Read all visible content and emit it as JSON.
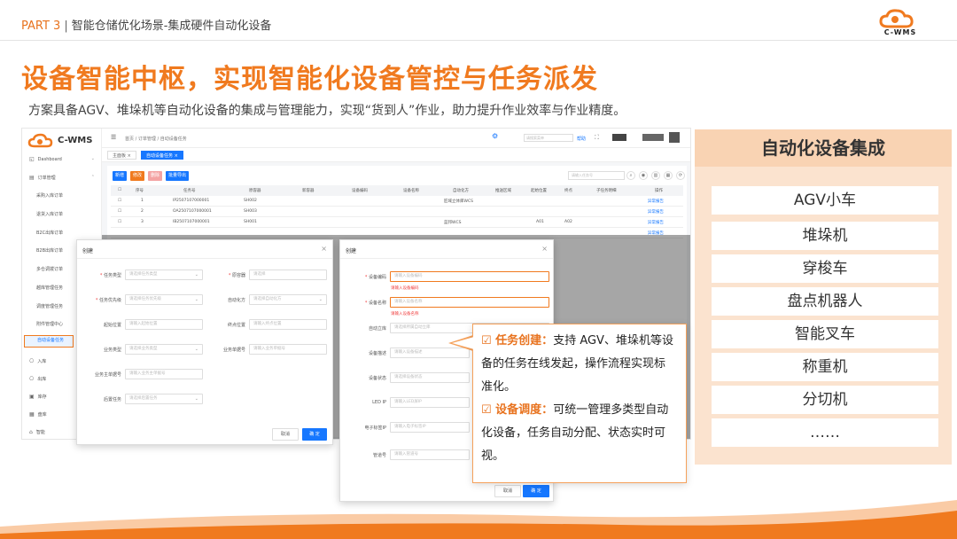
{
  "header": {
    "part": "PART 3",
    "section": "智能仓储优化场景-集成硬件自动化设备",
    "logo_text": "C-WMS"
  },
  "title": "设备智能中枢，实现智能化设备管控与任务派发",
  "subtitle": "方案具备AGV、堆垛机等自动化设备的集成与管理能力，实现“货到人”作业，助力提升作业效率与作业精度。",
  "app": {
    "logo_text": "C-WMS",
    "sidebar": [
      {
        "icon": "dashboard-icon",
        "label": "Dashboard"
      },
      {
        "icon": "order-icon",
        "label": "订单管理"
      },
      {
        "label": "采购入库订单"
      },
      {
        "label": "退货入库订单"
      },
      {
        "label": "B2C出库订单"
      },
      {
        "label": "B2B出库订单"
      },
      {
        "label": "多仓调拨订单"
      },
      {
        "label": "越库管理任务"
      },
      {
        "label": "调度管理任务"
      },
      {
        "label": "附件管理中心"
      },
      {
        "label": "自动设备任务"
      },
      {
        "icon": "inbound-icon",
        "label": "入库"
      },
      {
        "icon": "outbound-icon",
        "label": "出库"
      },
      {
        "icon": "stock-icon",
        "label": "库存"
      },
      {
        "icon": "inventory-icon",
        "label": "盘库"
      },
      {
        "icon": "smart-icon",
        "label": "智能"
      }
    ],
    "breadcrumb": "首页 / 订单管理 / 自动设备任务",
    "topbar": {
      "search_placeholder": "请搜索菜单",
      "help": "帮助"
    },
    "tabs": [
      "主面板",
      "自动设备任务"
    ],
    "toolbar": {
      "buttons": [
        "新增",
        "修改",
        "删除",
        "批量导出"
      ],
      "search_placeholder": "请输入任务号"
    },
    "table": {
      "headers": [
        "序号",
        "任务号",
        "原容器",
        "新容器",
        "设备编码",
        "设备名称",
        "自动化方",
        "推送区域",
        "起始位置",
        "终点",
        "子任务明细",
        "操作"
      ],
      "rows": [
        {
          "no": "1",
          "task": "IP2507107000001",
          "src": "SH002",
          "auto": "匠域立体库WCS",
          "start": "",
          "end": "",
          "op": "异常报告"
        },
        {
          "no": "2",
          "task": "OA2507107000001",
          "src": "SH003",
          "auto": "",
          "start": "",
          "end": "",
          "op": "异常报告"
        },
        {
          "no": "3",
          "task": "IB2507107000001",
          "src": "SH001",
          "auto": "蓝邦WCS",
          "start": "A01",
          "end": "A02",
          "op": "异常报告"
        },
        {
          "no": "",
          "task": "",
          "src": "",
          "auto": "",
          "start": "",
          "end": "",
          "op": "异常报告"
        }
      ]
    },
    "dialog1": {
      "title": "创建",
      "fields": [
        {
          "label": "任务类型",
          "required": true,
          "placeholder": "请选择任务类型"
        },
        {
          "label": "原容器",
          "required": true,
          "placeholder": "请选择"
        },
        {
          "label": "任务优先级",
          "required": true,
          "placeholder": "请选择任务优先级"
        },
        {
          "label": "自动化方",
          "required": false,
          "placeholder": "请选择自动化方"
        },
        {
          "label": "起始位置",
          "required": false,
          "placeholder": "请输入起始位置"
        },
        {
          "label": "终点位置",
          "required": false,
          "placeholder": "请输入终点位置"
        },
        {
          "label": "业务类型",
          "required": false,
          "placeholder": "请选择业务类型"
        },
        {
          "label": "业务单据号",
          "required": false,
          "placeholder": "请输入业务单据号"
        },
        {
          "label": "业务主单据号",
          "required": false,
          "placeholder": "请输入业务主单据号"
        },
        {
          "label": "后置任务",
          "required": false,
          "placeholder": "请选择后置任务"
        }
      ],
      "cancel": "取消",
      "ok": "确 定"
    },
    "dialog2": {
      "title": "创建",
      "fields": [
        {
          "label": "设备编码",
          "required": true,
          "placeholder": "请输入设备编码",
          "error": "请输入设备编码"
        },
        {
          "label": "设备名称",
          "required": true,
          "placeholder": "请输入设备名称",
          "error": "请输入设备名称"
        },
        {
          "label": "自动立库",
          "required": false,
          "placeholder": "请选择所属自动立库"
        },
        {
          "label": "设备描述",
          "required": false,
          "placeholder": "请输入设备描述"
        },
        {
          "label": "设备状态",
          "required": false,
          "placeholder": "请选择设备状态"
        },
        {
          "label": "LED IP",
          "required": false,
          "placeholder": "请输入LED屏IP"
        },
        {
          "label": "电子标签IP",
          "required": false,
          "placeholder": "请输入电子标签IP"
        },
        {
          "label": "管道号",
          "required": false,
          "placeholder": "请输入管道号"
        }
      ],
      "cancel": "取消",
      "ok": "确 定"
    }
  },
  "callout": {
    "item1_head": "☑ 任务创建：",
    "item1_body_a": "支持 AGV、堆垛机等设",
    "item1_body_b": "备的任务在线发起，操作流程实现标",
    "item1_body_c": "准化。",
    "item2_head": "☑ 设备调度：",
    "item2_body_a": "可统一管理多类型自动",
    "item2_body_b": "化设备，任务自动分配、状态实时可",
    "item2_body_c": "视。"
  },
  "right_panel": {
    "title": "自动化设备集成",
    "items": [
      "AGV小车",
      "堆垛机",
      "穿梭车",
      "盘点机器人",
      "智能叉车",
      "称重机",
      "分切机",
      "……"
    ]
  },
  "colors": {
    "accent": "#f07a1f",
    "primary": "#1677ff",
    "panel_bg": "#fbe3cf"
  }
}
